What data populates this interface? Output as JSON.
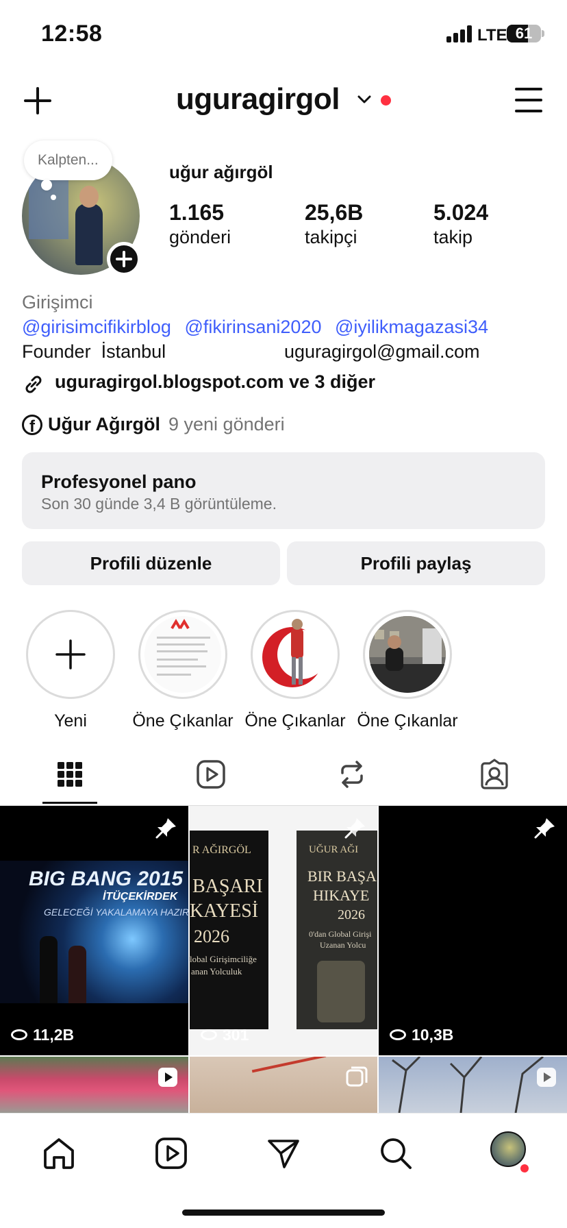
{
  "status_bar": {
    "time": "12:58",
    "network": "LTE",
    "battery": "61",
    "battery_level": 0.61
  },
  "header": {
    "username": "uguragirgol"
  },
  "note": {
    "text": "Kalpten..."
  },
  "profile": {
    "full_name": "uğur ağırgöl",
    "stats": [
      {
        "value": "1.165",
        "label": "gönderi"
      },
      {
        "value": "25,6B",
        "label": "takipçi"
      },
      {
        "value": "5.024",
        "label": "takip"
      }
    ]
  },
  "bio": {
    "category": "Girişimci",
    "mentions": [
      "@girisimcifikirblog",
      "@fikirinsani2020",
      "@iyilikmagazasi34"
    ],
    "line": "Founder  İstanbul",
    "email": "uguragirgol@gmail.com",
    "link": "uguragirgol.blogspot.com ve 3 diğer",
    "facebook_name": "Uğur Ağırgöl",
    "facebook_new": "9 yeni gönderi"
  },
  "dashboard": {
    "title": "Profesyonel pano",
    "subtitle": "Son 30 günde 3,4 B görüntüleme."
  },
  "buttons": {
    "edit": "Profili düzenle",
    "share": "Profili paylaş"
  },
  "highlights": [
    {
      "label": "Yeni"
    },
    {
      "label": "Öne Çıkanlar"
    },
    {
      "label": "Öne Çıkanlar"
    },
    {
      "label": "Öne Çıkanlar"
    }
  ],
  "posts": [
    {
      "views": "11,2B",
      "poster_title": "BIG BANG 2015",
      "poster_sub": "GELECEĞİ YAKALAMAYA HAZIR MISINIZ?",
      "poster_brand": "İTÜÇEKİRDEK"
    },
    {
      "views": "301",
      "book_author": "R AĞIRGÖL",
      "book_title1": "BAŞARI",
      "book_title2": "KAYESİ",
      "book_year": "2026",
      "book_sub": "lobal Girişimciliğe",
      "book_sub2": "anan Yolculuk",
      "book2_author": "UĞUR AĞI",
      "book2_title1": "BIR BAŞA",
      "book2_title2": "HIKAYE",
      "book2_year": "2026",
      "book2_sub": "0'dan Global Girişi",
      "book2_sub2": "Uzanan Yolcu"
    },
    {
      "views": "10,3B"
    }
  ],
  "colors": {
    "accent": "#3f5efb",
    "notification": "#ff3040",
    "surface": "#efeff1",
    "muted": "#737373"
  }
}
